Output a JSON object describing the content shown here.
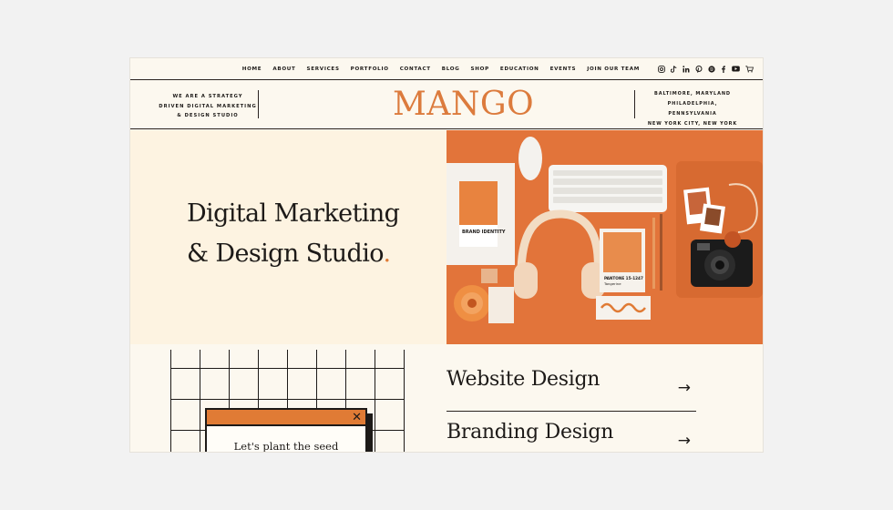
{
  "nav": {
    "links": [
      "HOME",
      "ABOUT",
      "SERVICES",
      "PORTFOLIO",
      "CONTACT",
      "BLOG",
      "SHOP",
      "EDUCATION",
      "EVENTS",
      "JOIN OUR TEAM"
    ],
    "social_icons": [
      "instagram-icon",
      "tiktok-icon",
      "linkedin-icon",
      "pinterest-icon",
      "spotify-icon",
      "facebook-icon",
      "youtube-icon",
      "cart-icon"
    ]
  },
  "header": {
    "tagline_lines": [
      "WE ARE A STRATEGY",
      "DRIVEN DIGITAL MARKETING",
      "& DESIGN STUDIO"
    ],
    "logo": "MANGO",
    "cities": [
      "BALTIMORE, MARYLAND",
      "PHILADELPHIA, PENNSYLVANIA",
      "NEW YORK CITY, NEW YORK"
    ]
  },
  "hero": {
    "title_line1": "Digital Marketing",
    "title_line2": "& Design Studio",
    "title_dot": "."
  },
  "photo": {
    "brand_card": "BRAND IDENTITY",
    "pantone": "PANTONE 15-1247",
    "pantone_name": "Tangerine"
  },
  "popup": {
    "close": "✕",
    "text": "Let's plant the seed"
  },
  "services": [
    {
      "name": "Website Design",
      "arrow": "→"
    },
    {
      "name": "Branding Design",
      "arrow": "→"
    }
  ],
  "colors": {
    "accent": "#e07b35",
    "cream": "#fdf3e1",
    "ink": "#1d1a18"
  }
}
